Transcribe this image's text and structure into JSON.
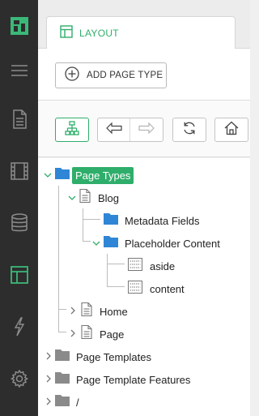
{
  "colors": {
    "accent": "#2fae6b",
    "rail": "#2d2d2d",
    "folder_blue": "#2f86d6",
    "folder_gray": "#8a8a8a"
  },
  "rail": {
    "items": [
      {
        "icon": "logo-icon"
      },
      {
        "icon": "hamburger-menu-icon"
      },
      {
        "icon": "document-icon"
      },
      {
        "icon": "film-icon"
      },
      {
        "icon": "database-icon"
      },
      {
        "icon": "layout-icon",
        "active": true
      },
      {
        "icon": "lightning-icon"
      },
      {
        "icon": "gear-icon"
      }
    ]
  },
  "tab": {
    "label": "LAYOUT"
  },
  "toolbar": {
    "add_label": "ADD PAGE TYPE"
  },
  "tree": {
    "items": [
      {
        "label": "Page Types",
        "icon": "folder",
        "selected": true
      },
      {
        "label": "Blog",
        "icon": "page"
      },
      {
        "label": "Metadata Fields",
        "icon": "folder"
      },
      {
        "label": "Placeholder Content",
        "icon": "folder"
      },
      {
        "label": "aside",
        "icon": "placeholder"
      },
      {
        "label": "content",
        "icon": "placeholder"
      },
      {
        "label": "Home",
        "icon": "page"
      },
      {
        "label": "Page",
        "icon": "page"
      },
      {
        "label": "Page Templates",
        "icon": "folder"
      },
      {
        "label": "Page Template Features",
        "icon": "folder"
      },
      {
        "label": "/",
        "icon": "folder"
      }
    ]
  }
}
